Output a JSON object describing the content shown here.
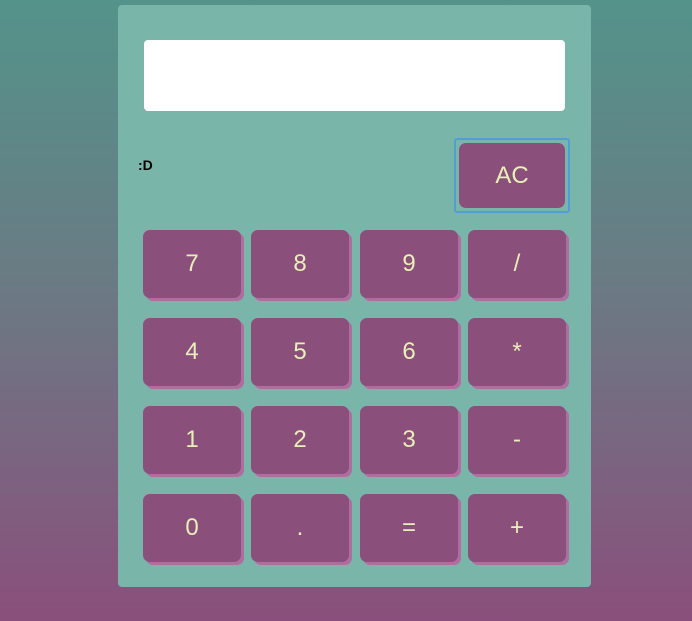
{
  "display": {
    "value": ""
  },
  "face_label": ":D",
  "clear_label": "AC",
  "keypad": [
    [
      "7",
      "8",
      "9",
      "/"
    ],
    [
      "4",
      "5",
      "6",
      "*"
    ],
    [
      "1",
      "2",
      "3",
      "-"
    ],
    [
      "0",
      ".",
      "=",
      "+"
    ]
  ],
  "colors": {
    "panel": "#79b5a9",
    "button": "#8b4f7b",
    "button_text": "#e8efb8",
    "focus_ring": "#4f9fd6"
  }
}
